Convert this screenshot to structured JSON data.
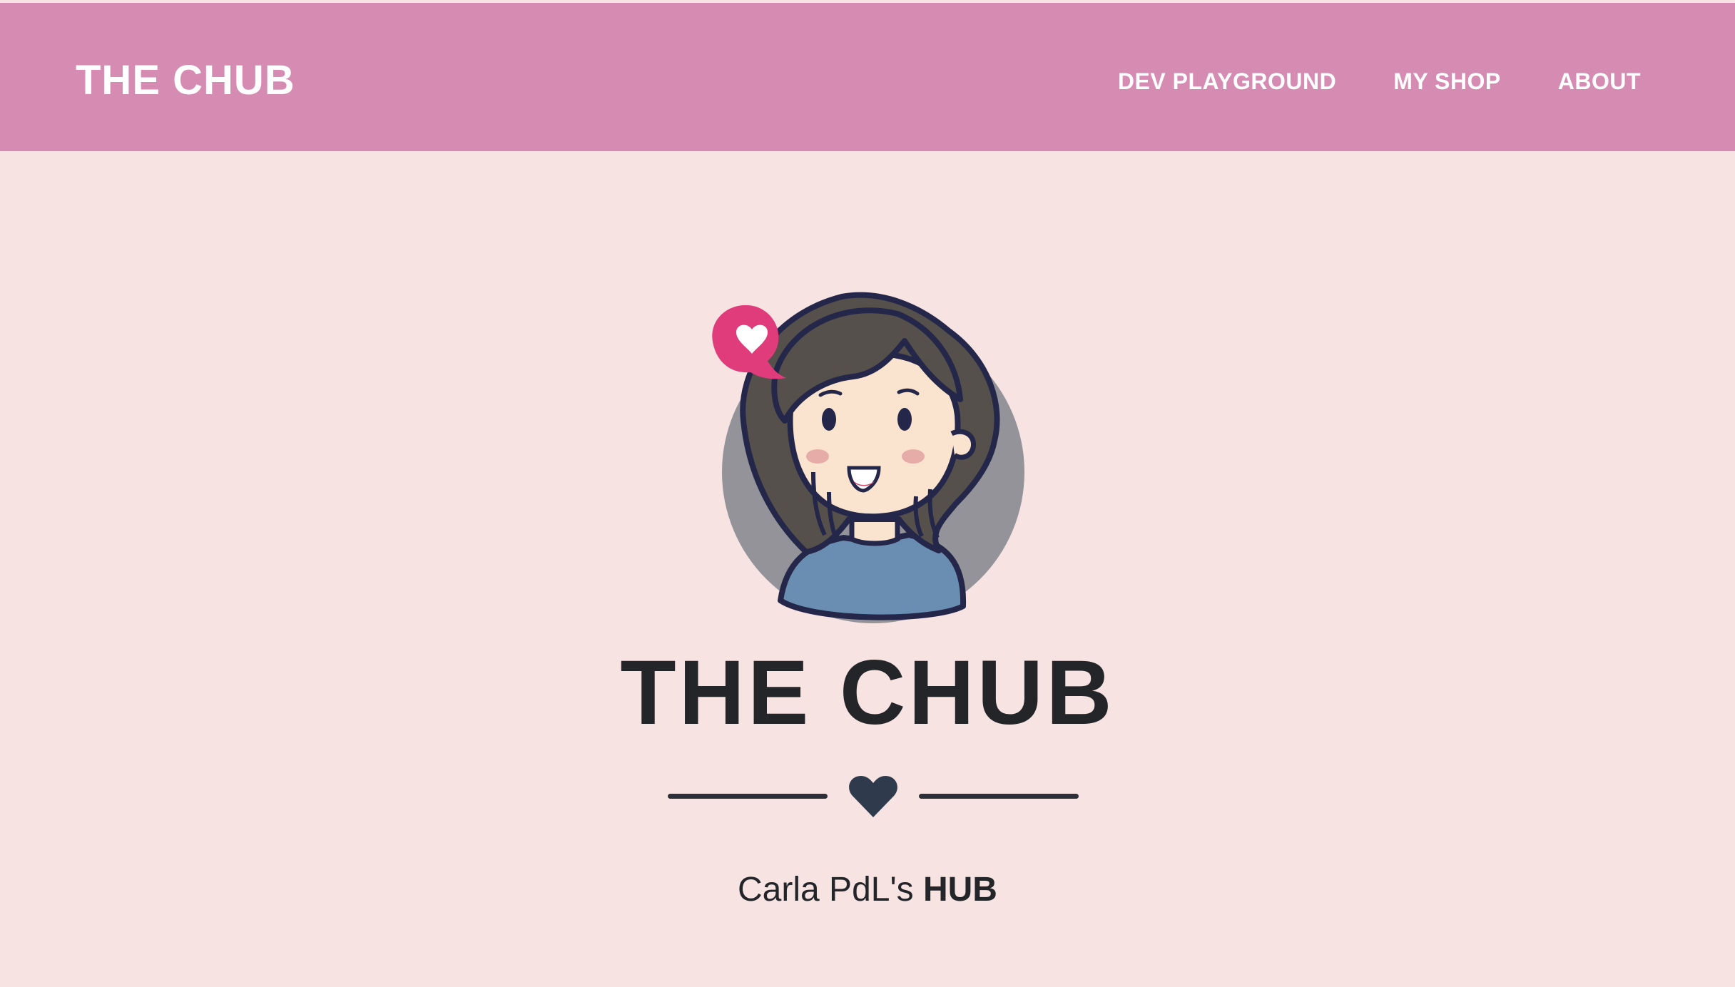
{
  "nav": {
    "brand": "THE CHUB",
    "links": [
      "DEV PLAYGROUND",
      "MY SHOP",
      "ABOUT"
    ]
  },
  "hero": {
    "title": "THE CHUB",
    "subtitle_prefix": "Carla PdL's",
    "subtitle_bold": "HUB",
    "divider_icon": "heart-icon",
    "avatar_icon": "cartoon-girl-avatar"
  },
  "colors": {
    "navbar_bg": "#d68bb3",
    "page_bg": "#f8e3e3",
    "text_dark": "#232529",
    "accent_pink": "#e03c7c",
    "shirt_blue": "#6a8eb1",
    "hair": "#56504c"
  }
}
